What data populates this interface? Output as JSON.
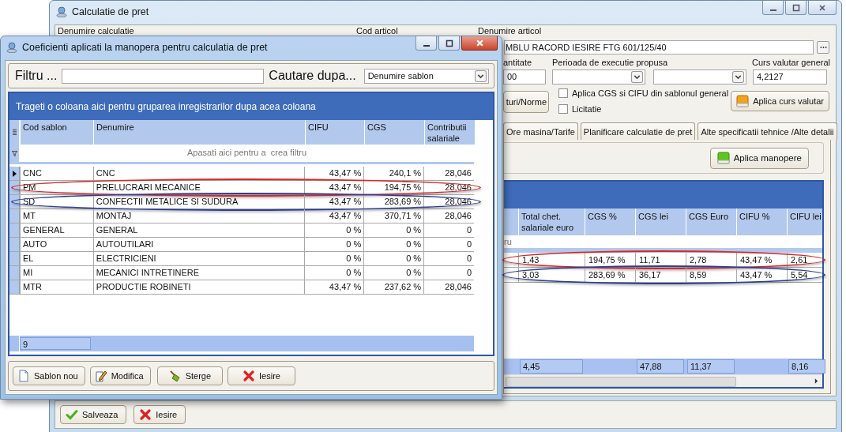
{
  "main_window": {
    "title": "Calculatie de pret",
    "field_labels": [
      "Denumire calculatie",
      "Cod articol",
      "Denumire articol"
    ],
    "denumire_articol": "MBLU RACORD IESIRE FTG 601/125/40",
    "cantitate": {
      "label": "antitate",
      "value": "00"
    },
    "perioada": {
      "label": "Perioada de executie propusa"
    },
    "curs": {
      "label": "Curs valutar general",
      "value": "4,2127"
    },
    "norme_button": "turi/Norme",
    "checkboxes": [
      {
        "label": "Aplica CGS si CIFU din sablonul general",
        "checked": false
      },
      {
        "label": "Licitatie",
        "checked": false
      }
    ],
    "curs_button": "Aplica curs valutar",
    "tabs": [
      {
        "label": "Ore masina/Tarife",
        "selected": false
      },
      {
        "label": "Planificare calculatie de pret",
        "selected": false
      },
      {
        "label": "Alte specificatii tehnice /Alte detalii",
        "selected": false
      }
    ],
    "manopere_button": "Aplica manopere",
    "grid": {
      "columns": [
        "Total chet. salariale euro",
        "CGS %",
        "CGS lei",
        "CGS Euro",
        "CIFU %",
        "CIFU lei"
      ],
      "filter_hint": "ru",
      "rows": [
        {
          "cells": [
            "1,43",
            "194,75 %",
            "11,71",
            "2,78",
            "43,47 %",
            "2,61"
          ],
          "color": "#d42a2a"
        },
        {
          "cells": [
            "3,03",
            "283,69 %",
            "36,17",
            "8,59",
            "43,47 %",
            "5,54"
          ],
          "color": "#2e3f94"
        }
      ],
      "footer": [
        {
          "kind": "total",
          "value": "4,45"
        },
        {
          "kind": "blank"
        },
        {
          "kind": "total",
          "value": "47,88"
        },
        {
          "kind": "total",
          "value": "11,37"
        },
        {
          "kind": "blank"
        },
        {
          "kind": "total",
          "value": "8,16"
        }
      ]
    },
    "buttons": [
      {
        "label": "Salveaza",
        "kind": "save"
      },
      {
        "label": "Iesire",
        "kind": "exit"
      }
    ]
  },
  "dialog": {
    "title": "Coeficienti aplicati la manopera pentru calculatia de pret",
    "filter_label": "Filtru ...",
    "search_label": "Cautare dupa...",
    "search_by": "Denumire sablon",
    "group_hint": "Trageti o coloana aici pentru gruparea inregistrarilor dupa acea coloana",
    "columns": [
      "Cod sablon",
      "Denumire",
      "CIFU",
      "CGS",
      "Contributii salariale"
    ],
    "filter_hint": "Apasati aici pentru a  crea filtru",
    "rows": [
      {
        "cells": [
          "CNC",
          "CNC",
          "43,47 %",
          "240,1 %",
          "28,046"
        ],
        "current": true
      },
      {
        "cells": [
          "PM",
          "PRELUCRARI MECANICE",
          "43,47 %",
          "194,75 %",
          "28,046"
        ],
        "current": false,
        "color": "#d42a2a"
      },
      {
        "cells": [
          "SD",
          "CONFECTII METALICE SI SUDURA",
          "43,47 %",
          "283,69 %",
          "28,046"
        ],
        "current": false,
        "color": "#2e3f94"
      },
      {
        "cells": [
          "MT",
          "MONTAJ",
          "43,47 %",
          "370,71 %",
          "28,046"
        ],
        "current": false
      },
      {
        "cells": [
          "GENERAL",
          "GENERAL",
          "0 %",
          "0 %",
          "0"
        ],
        "current": false
      },
      {
        "cells": [
          "AUTO",
          "AUTOUTILARI",
          "0 %",
          "0 %",
          "0"
        ],
        "current": false
      },
      {
        "cells": [
          "EL",
          "ELECTRICIENI",
          "0 %",
          "0 %",
          "0"
        ],
        "current": false
      },
      {
        "cells": [
          "MI",
          "MECANICI INTRETINERE",
          "0 %",
          "0 %",
          "0"
        ],
        "current": false
      },
      {
        "cells": [
          "MTR",
          "PRODUCTIE ROBINETI",
          "43,47 %",
          "237,62 %",
          "28,046"
        ],
        "current": false
      }
    ],
    "count": "9",
    "buttons": [
      {
        "label": "Sablon nou",
        "kind": "new"
      },
      {
        "label": "Modifica",
        "kind": "edit"
      },
      {
        "label": "Sterge",
        "kind": "delete"
      },
      {
        "label": "Iesire",
        "kind": "exit"
      }
    ]
  }
}
